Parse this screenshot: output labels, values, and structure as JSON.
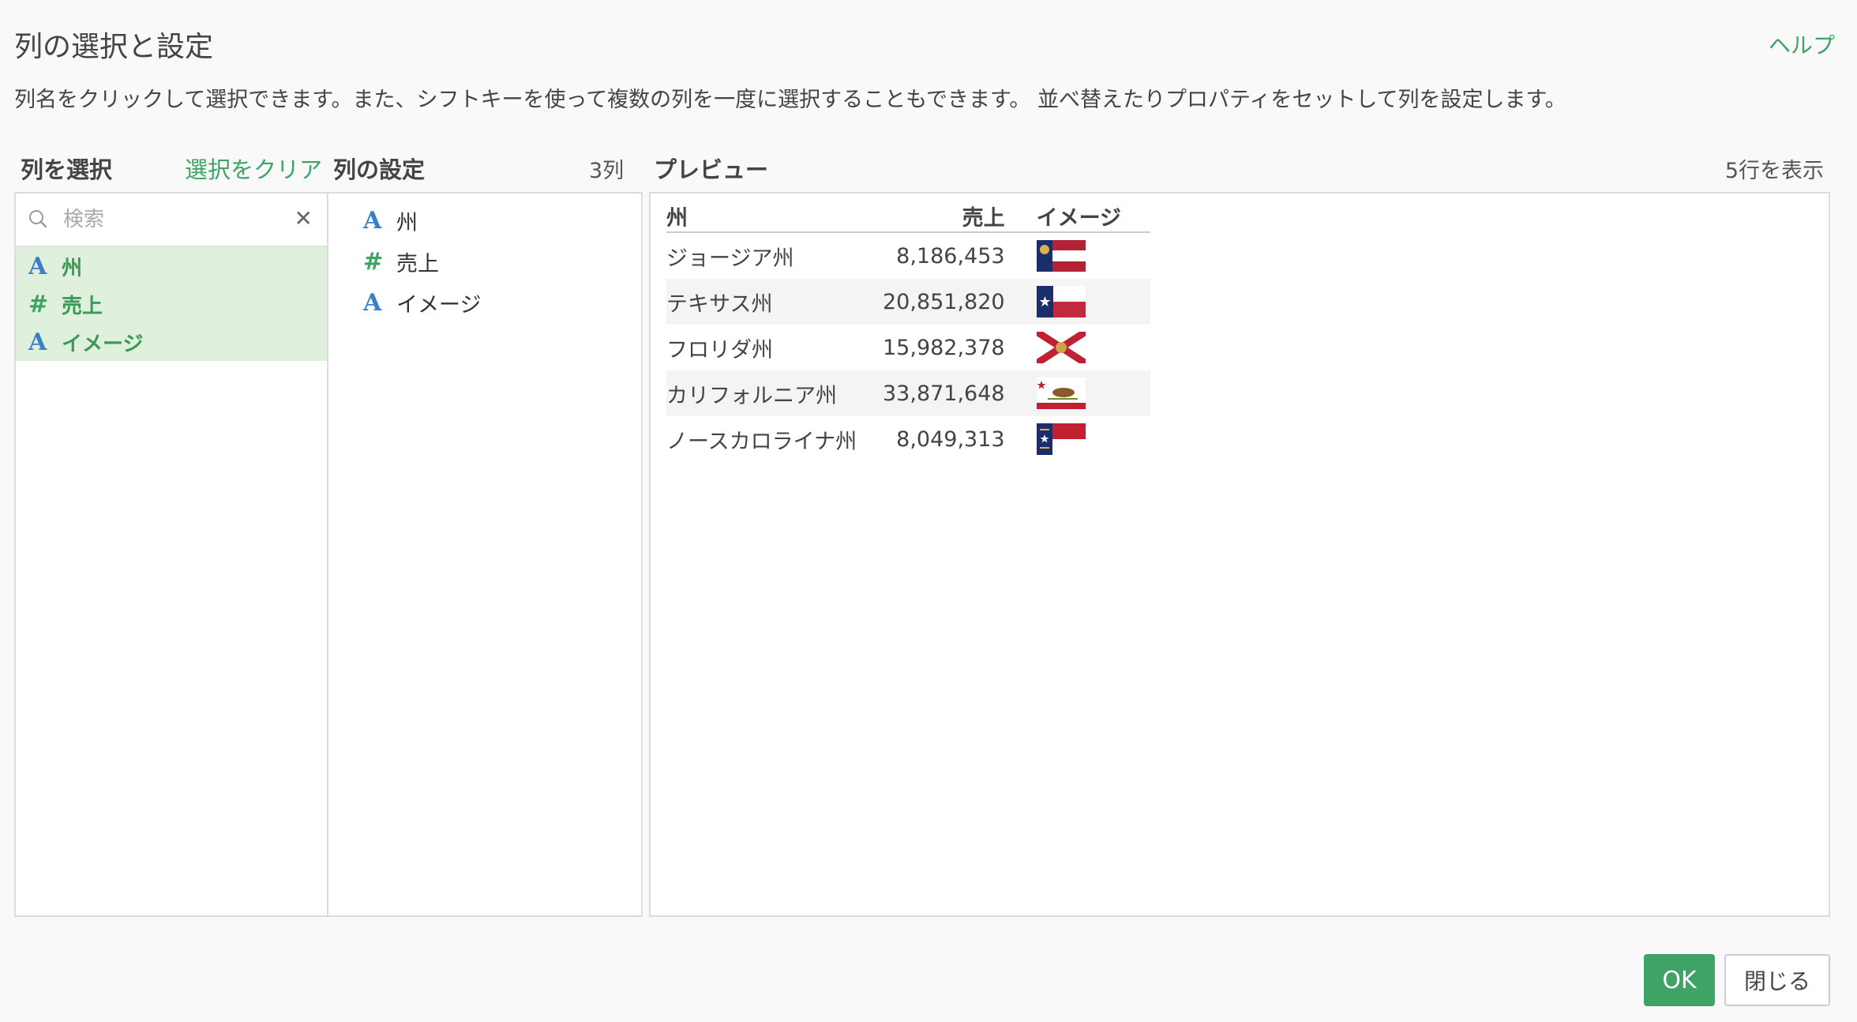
{
  "dialog": {
    "title": "列の選択と設定",
    "help_label": "ヘルプ",
    "description": "列名をクリックして選択できます。また、シフトキーを使って複数の列を一度に選択することもできます。 並べ替えたりプロパティをセットして列を設定します。"
  },
  "select_columns": {
    "label": "列を選択",
    "clear_label": "選択をクリア",
    "search_placeholder": "検索",
    "items": [
      {
        "type_icon": "A",
        "name": "州"
      },
      {
        "type_icon": "#",
        "name": "売上"
      },
      {
        "type_icon": "A",
        "name": "イメージ"
      }
    ]
  },
  "column_settings": {
    "label": "列の設定",
    "count": "3列",
    "items": [
      {
        "type_icon": "A",
        "name": "州"
      },
      {
        "type_icon": "#",
        "name": "売上"
      },
      {
        "type_icon": "A",
        "name": "イメージ"
      }
    ]
  },
  "preview": {
    "label": "プレビュー",
    "rows_info": "5行を表示",
    "headers": [
      "州",
      "売上",
      "イメージ"
    ],
    "rows": [
      {
        "state": "ジョージア州",
        "sales": "8,186,453",
        "flag": "georgia-flag"
      },
      {
        "state": "テキサス州",
        "sales": "20,851,820",
        "flag": "texas-flag"
      },
      {
        "state": "フロリダ州",
        "sales": "15,982,378",
        "flag": "florida-flag"
      },
      {
        "state": "カリフォルニア州",
        "sales": "33,871,648",
        "flag": "california-flag"
      },
      {
        "state": "ノースカロライナ州",
        "sales": "8,049,313",
        "flag": "north-carolina-flag"
      }
    ]
  },
  "footer": {
    "ok_label": "OK",
    "close_label": "閉じる"
  },
  "colors": {
    "accent": "#3fa366",
    "selected_bg": "#dff0dd",
    "string_type": "#3b7fc4"
  }
}
